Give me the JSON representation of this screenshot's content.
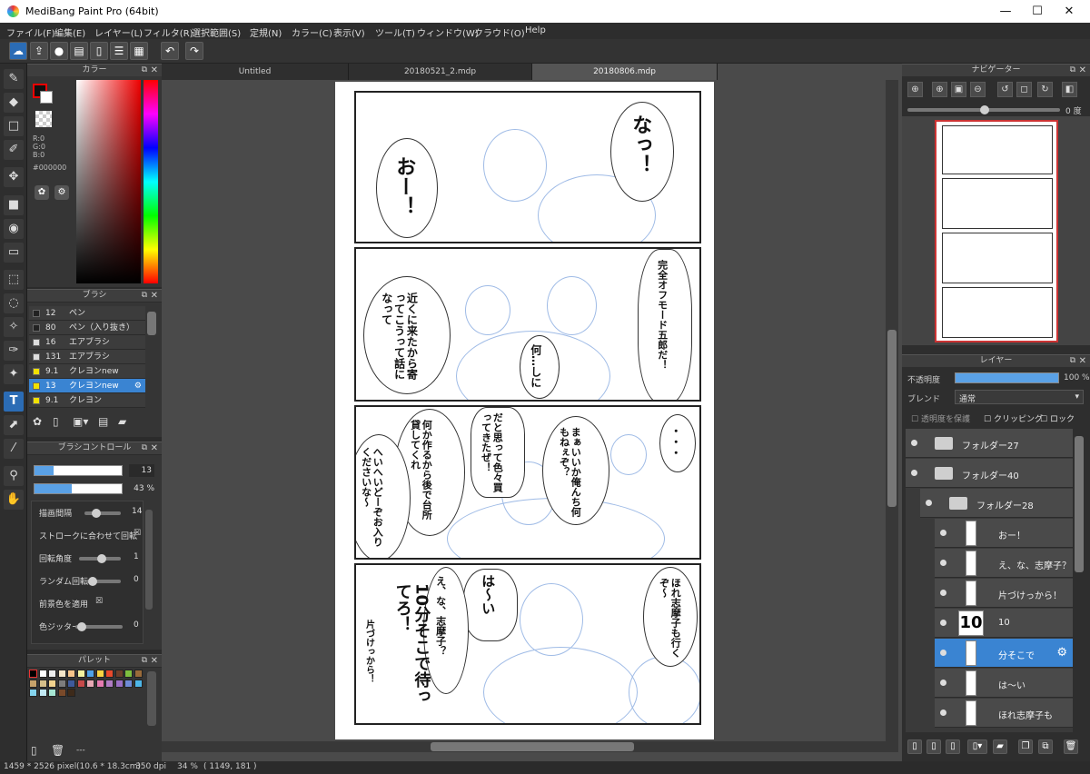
{
  "window": {
    "title": "MediBang Paint Pro (64bit)",
    "minimize": "—",
    "maximize": "☐",
    "close": "✕"
  },
  "menu": [
    "ファイル(F)",
    "編集(E)",
    "レイヤー(L)",
    "フィルタ(R)",
    "選択範囲(S)",
    "定規(N)",
    "カラー(C)",
    "表示(V)",
    "ツール(T)",
    "ウィンドウ(W)",
    "クラウド(O)",
    "Help"
  ],
  "color_panel": {
    "title": "カラー",
    "r": "R:0",
    "g": "G:0",
    "b": "B:0",
    "hex": "#000000"
  },
  "brush_panel": {
    "title": "ブラシ",
    "items": [
      {
        "size": "12",
        "name": "ペン",
        "color": "#222222"
      },
      {
        "size": "80",
        "name": "ペン（入り抜き）",
        "color": "#222222"
      },
      {
        "size": "16",
        "name": "エアブラシ",
        "color": "#dddddd"
      },
      {
        "size": "131",
        "name": "エアブラシ",
        "color": "#dddddd"
      },
      {
        "size": "9.1",
        "name": "クレヨンnew",
        "color": "#f1e100"
      },
      {
        "size": "13",
        "name": "クレヨンnew",
        "color": "#f1e100"
      },
      {
        "size": "9.1",
        "name": "クレヨン",
        "color": "#f1e100"
      }
    ]
  },
  "brush_control": {
    "title": "ブラシコントロール",
    "size_value": "13",
    "opacity_value": "43 %",
    "size_fill": 0.22,
    "opacity_fill": 0.43,
    "rows": [
      {
        "label": "描画間隔",
        "value": "14"
      },
      {
        "label": "ストロークに合わせて回転",
        "value": "☒"
      },
      {
        "label": "回転角度",
        "value": "1"
      },
      {
        "label": "ランダム回転",
        "value": "0"
      },
      {
        "label": "前景色を適用",
        "value": "☒"
      },
      {
        "label": "色ジッター",
        "value": "0"
      }
    ]
  },
  "palette": {
    "title": "パレット",
    "footer": "---",
    "colors": [
      "#000000",
      "#ffffff",
      "#eeeeee",
      "#f4e6c8",
      "#f6c58a",
      "#f3f3a0",
      "#4ea2e8",
      "#f7d443",
      "#e84a2c",
      "#6b3f2b",
      "#7fbf3f",
      "#9a6b3a",
      "#c7a36b",
      "#d6c08a",
      "#f1d28e",
      "#7d7d7d",
      "#3e5a9c",
      "#c64a4a",
      "#e8a9b5",
      "#e57bb0",
      "#b07cc3",
      "#9b6fc4",
      "#6f8bd6",
      "#4db6e8",
      "#84d4ee",
      "#c2eaf5",
      "#a7e6d3",
      "#7a4a2a",
      "#3d2a1a"
    ]
  },
  "tabs": [
    "Untitled",
    "20180521_2.mdp",
    "20180806.mdp"
  ],
  "manga": {
    "p1_a": "なっ！",
    "p1_b": "おー！",
    "p2_a": "完全オフモード五郎だ！",
    "p2_b": "近くに来たから寄ってこうって話になって",
    "p2_c": "何…しに",
    "p3_a": "・・・",
    "p3_b": "まぁいいか俺んち何もねぇぞ？",
    "p3_c": "だと思って色々買ってきたぜ！",
    "p3_d": "何か作るから後で台所貸してくれ",
    "p3_e": "へいへいどーぞお入りくださいな〜",
    "p4_a": "ほれ志摩子も行くぞ〜",
    "p4_b": "は〜い",
    "p4_c": "え、な、志摩子？",
    "p4_d": "10分そこで待ってろ！",
    "p4_e": "片づけっから！"
  },
  "navigator": {
    "title": "ナビゲーター",
    "angle": "0 度"
  },
  "layer_panel": {
    "title": "レイヤー",
    "opacity_label": "不透明度",
    "opacity_value": "100 %",
    "blend_label": "ブレンド",
    "blend_value": "通常",
    "protect": "透明度を保護",
    "clipping": "クリッピング",
    "lock": "ロック",
    "layers": [
      {
        "name": "フォルダー27",
        "type": "folder",
        "indent": 0
      },
      {
        "name": "フォルダー40",
        "type": "folder",
        "indent": 0
      },
      {
        "name": "フォルダー28",
        "type": "folder",
        "indent": 1
      },
      {
        "name": "おー！",
        "type": "layer",
        "indent": 2
      },
      {
        "name": "え、な、志摩子？",
        "type": "layer",
        "indent": 2
      },
      {
        "name": "片づけっから！",
        "type": "layer",
        "indent": 2
      },
      {
        "name": "10",
        "type": "layer",
        "indent": 2,
        "thumb": "10"
      },
      {
        "name": "分そこで",
        "type": "layer",
        "indent": 2,
        "selected": true
      },
      {
        "name": "は〜い",
        "type": "layer",
        "indent": 2
      },
      {
        "name": "ほれ志摩子も",
        "type": "layer",
        "indent": 2
      }
    ]
  },
  "status": {
    "dims": "1459 * 2526 pixel",
    "cm": "(10.6 * 18.3cm)",
    "dpi": "350 dpi",
    "zoom": "34 %",
    "coord": "( 1149, 181 )"
  }
}
